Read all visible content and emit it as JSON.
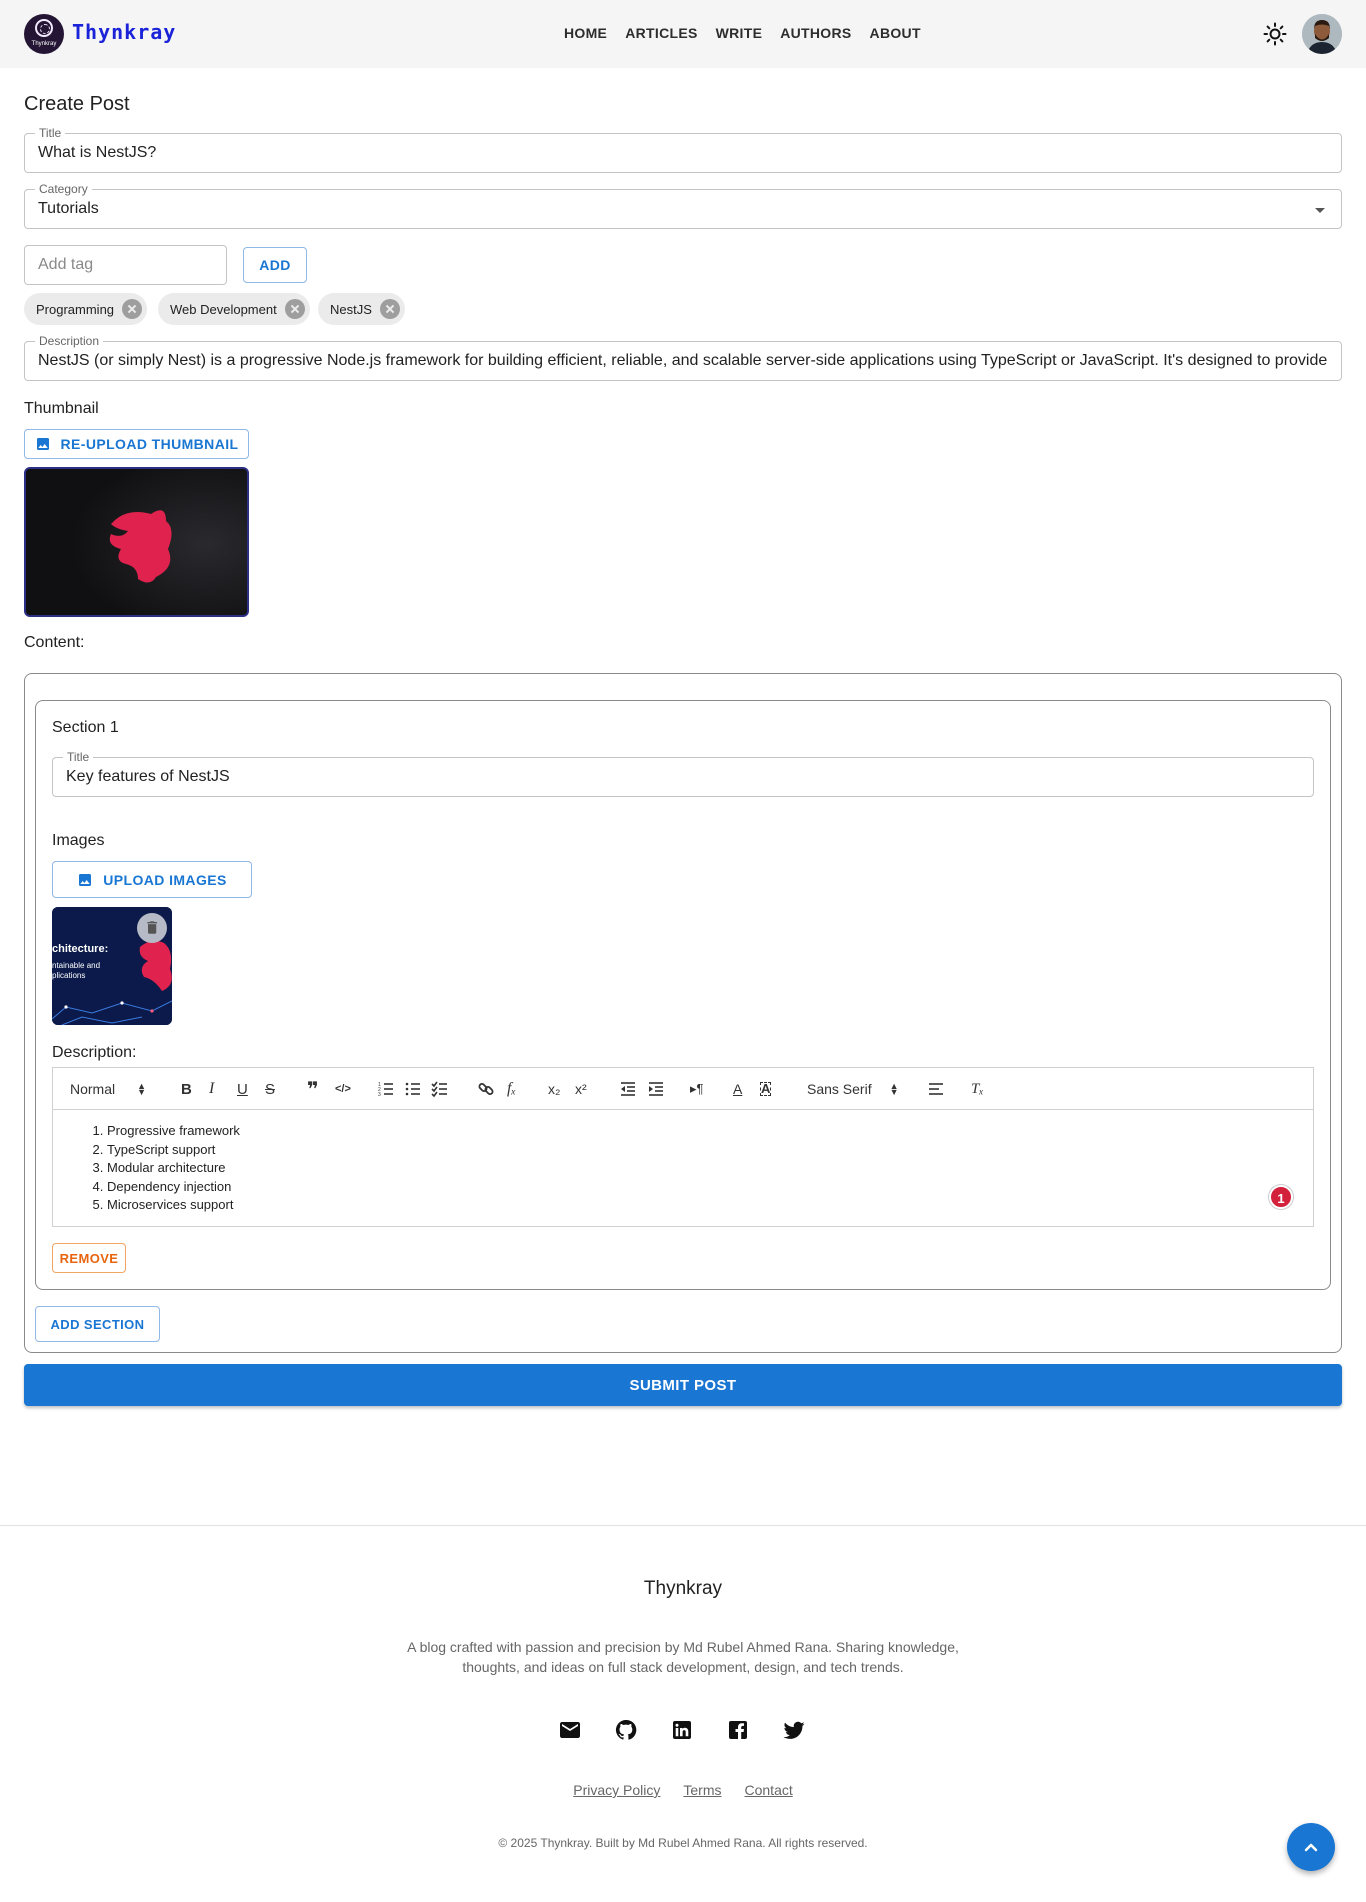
{
  "header": {
    "logo_text": "Thynkray",
    "brand": "Thynkray",
    "nav": [
      "HOME",
      "ARTICLES",
      "WRITE",
      "AUTHORS",
      "ABOUT"
    ],
    "theme_icon": "sun-icon",
    "avatar_icon": "user-avatar"
  },
  "page": {
    "heading": "Create Post"
  },
  "form": {
    "title_label": "Title",
    "title_value": "What is NestJS?",
    "category_label": "Category",
    "category_value": "Tutorials",
    "tag_placeholder": "Add tag",
    "add_tag_label": "ADD",
    "tags": [
      "Programming",
      "Web Development",
      "NestJS"
    ],
    "description_label": "Description",
    "description_value": "NestJS (or simply Nest) is a progressive Node.js framework for building efficient, reliable, and scalable server-side applications using TypeScript or JavaScript. It's designed to provide",
    "thumbnail_label": "Thumbnail",
    "reupload_label": "RE-UPLOAD THUMBNAIL",
    "content_label": "Content:"
  },
  "section": {
    "heading": "Section 1",
    "title_label": "Title",
    "title_value": "Key features of NestJS",
    "images_label": "Images",
    "upload_label": "UPLOAD IMAGES",
    "image_caption_lines": [
      "chitecture:",
      "ntainable and",
      "plications"
    ],
    "description_label": "Description:",
    "toolbar": {
      "format": "Normal",
      "font": "Sans Serif"
    },
    "list_items": [
      "Progressive framework",
      "TypeScript support",
      "Modular architecture",
      "Dependency injection",
      "Microservices support"
    ],
    "badge_count": "1",
    "remove_label": "REMOVE"
  },
  "actions": {
    "add_section": "ADD SECTION",
    "submit": "SUBMIT POST"
  },
  "footer": {
    "title": "Thynkray",
    "description": "A blog crafted with passion and precision by Md Rubel Ahmed Rana. Sharing knowledge, thoughts, and ideas on full stack development, design, and tech trends.",
    "socials": [
      "email-icon",
      "github-icon",
      "linkedin-icon",
      "facebook-icon",
      "twitter-icon"
    ],
    "links": [
      "Privacy Policy",
      "Terms",
      "Contact"
    ],
    "copyright": "© 2025 Thynkray. Built by Md Rubel Ahmed Rana. All rights reserved."
  },
  "colors": {
    "primary": "#1976d2",
    "brand": "#1a23d8",
    "remove": "#e8650f",
    "badge": "#d3203b"
  }
}
